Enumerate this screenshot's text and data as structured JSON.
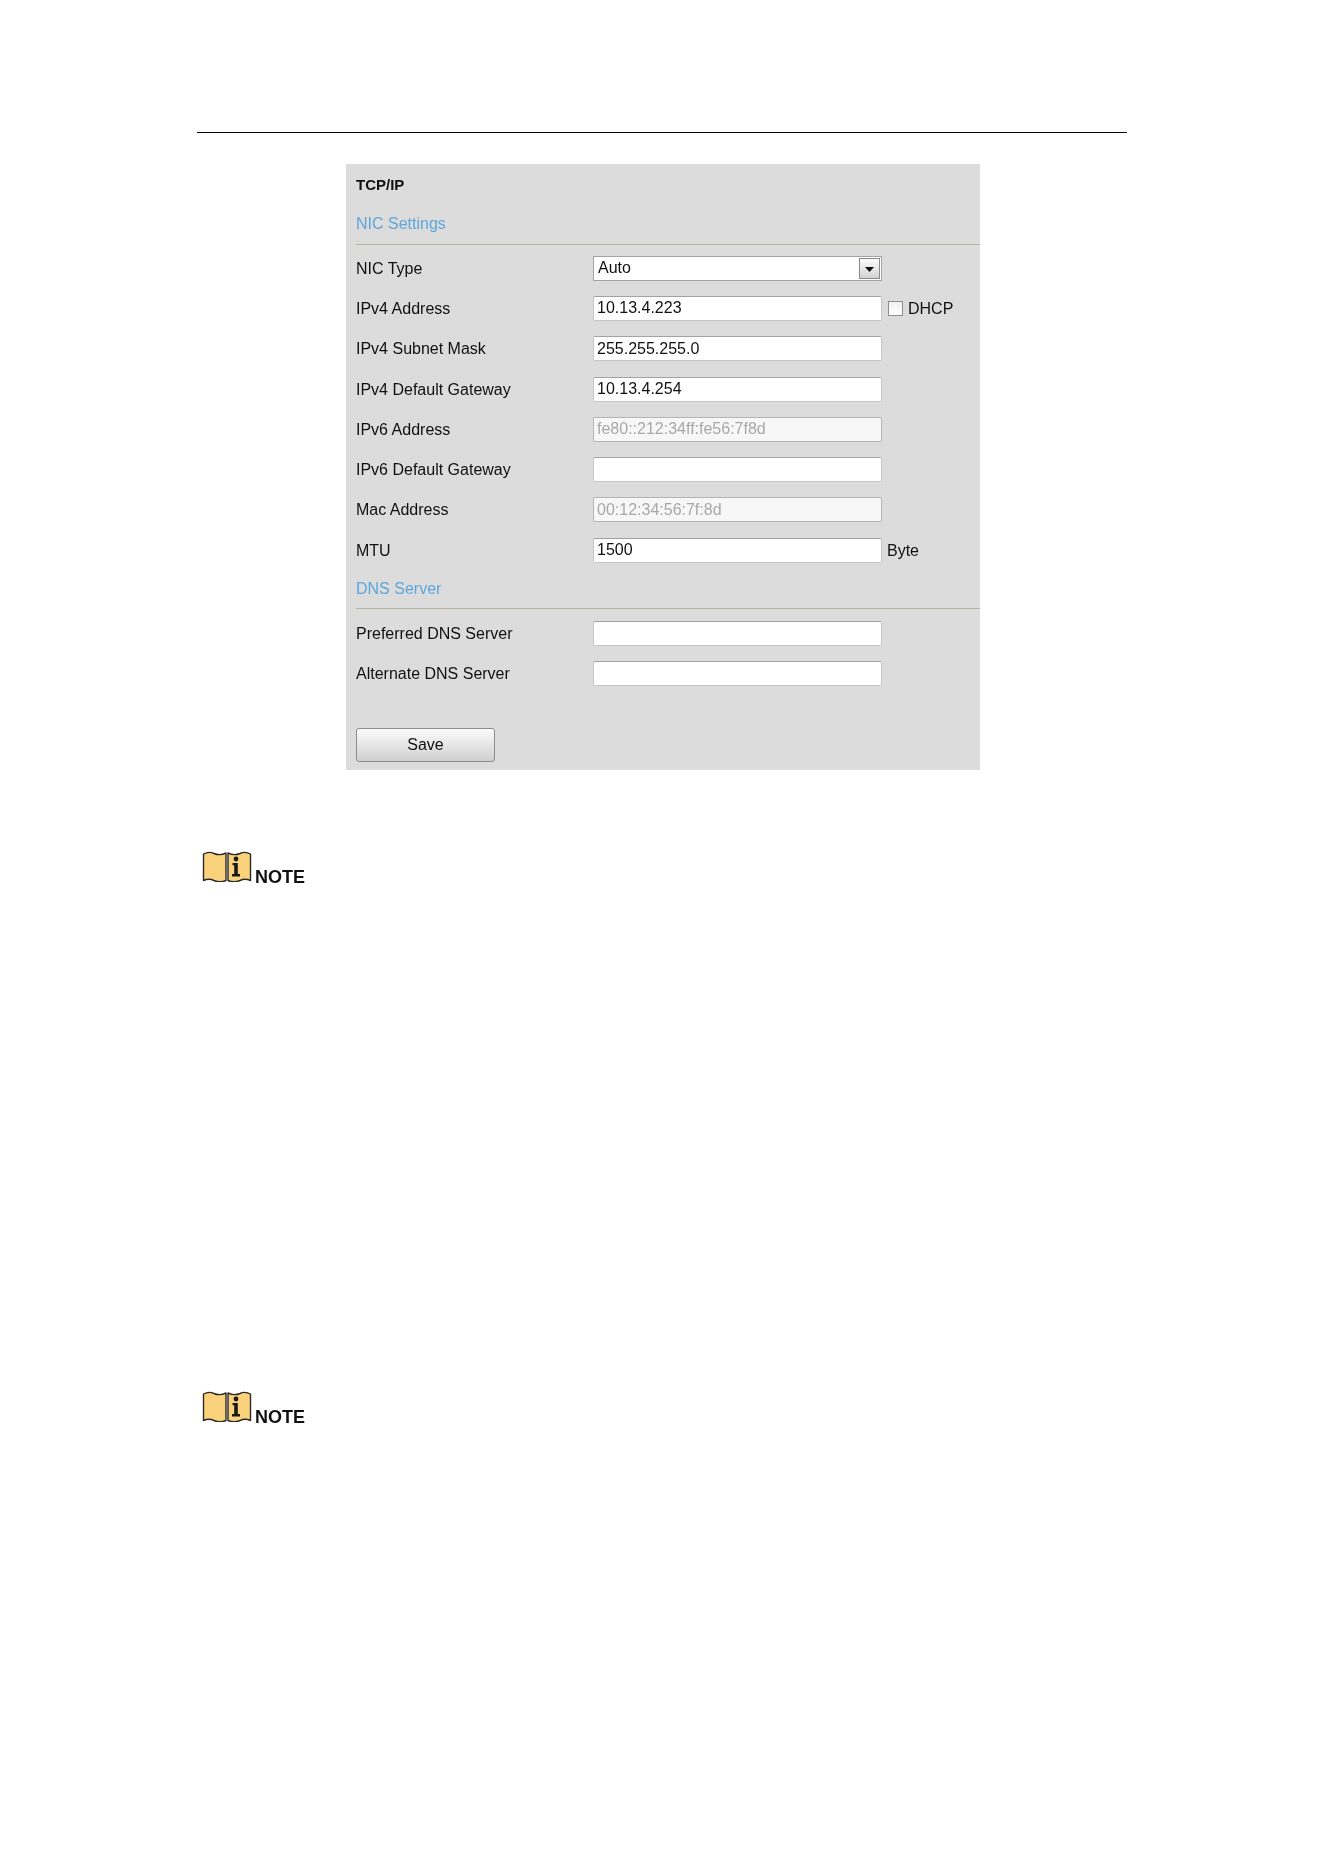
{
  "panel": {
    "title": "TCP/IP",
    "sections": [
      {
        "heading": "NIC Settings",
        "fields": [
          {
            "kind": "dropdown",
            "label": "NIC Type",
            "value": "Auto",
            "disabled": false
          },
          {
            "kind": "text",
            "label": "IPv4 Address",
            "value": "10.13.4.223",
            "disabled": false,
            "checkbox": {
              "label": "DHCP",
              "checked": false
            }
          },
          {
            "kind": "text",
            "label": "IPv4 Subnet Mask",
            "value": "255.255.255.0",
            "disabled": false
          },
          {
            "kind": "text",
            "label": "IPv4 Default Gateway",
            "value": "10.13.4.254",
            "disabled": false
          },
          {
            "kind": "text",
            "label": "IPv6 Address",
            "value": "fe80::212:34ff:fe56:7f8d",
            "disabled": true
          },
          {
            "kind": "text",
            "label": "IPv6 Default Gateway",
            "disabled": false
          },
          {
            "kind": "text",
            "label": "Mac Address",
            "value": "00:12:34:56:7f:8d",
            "disabled": true
          },
          {
            "kind": "text",
            "label": "MTU",
            "value": "1500",
            "disabled": false,
            "unit": "Byte"
          }
        ]
      },
      {
        "heading": "DNS Server",
        "fields": [
          {
            "kind": "text",
            "label": "Preferred DNS Server",
            "disabled": false
          },
          {
            "kind": "text",
            "label": "Alternate DNS Server",
            "disabled": false
          }
        ]
      }
    ],
    "save_button": "Save"
  },
  "notes": [
    {
      "label": "NOTE"
    },
    {
      "label": "NOTE"
    }
  ]
}
